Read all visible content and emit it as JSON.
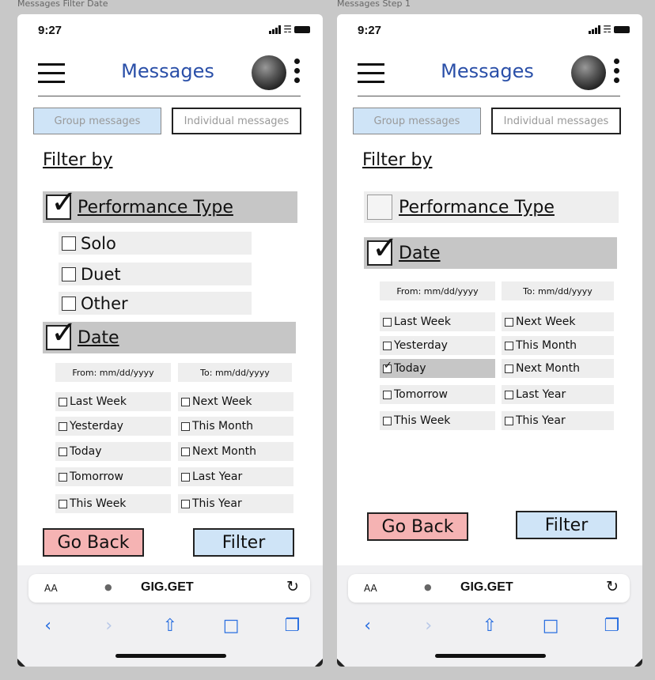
{
  "captions": [
    "Messages Filter Date",
    "Messages Step 1"
  ],
  "common": {
    "time": "9:27",
    "title": "Messages",
    "tabs": {
      "group": "Group messages",
      "individual": "Individual messages"
    },
    "filter_by": "Filter by",
    "sections": {
      "performance": "Performance Type",
      "date": "Date"
    },
    "perf_options": [
      "Solo",
      "Duet",
      "Other"
    ],
    "date_inputs": {
      "from": "From: mm/dd/yyyy",
      "to": "To: mm/dd/yyyy"
    },
    "date_left": [
      "Last Week",
      "Yesterday",
      "Today",
      "Tomorrow",
      "This Week"
    ],
    "date_right": [
      "Next Week",
      "This Month",
      "Next Month",
      "Last Year",
      "This Year"
    ],
    "buttons": {
      "back": "Go Back",
      "filter": "Filter"
    },
    "browser": {
      "aa": "AA",
      "domain": "GIG.GET",
      "lock_icon": "lock-icon",
      "reload_icon": "reload-icon"
    },
    "nav_icons": [
      "back-icon",
      "forward-icon",
      "share-icon",
      "bookmarks-icon",
      "tabs-icon"
    ]
  },
  "screens": [
    {
      "performance_checked": true,
      "date_checked": true,
      "today_checked": false
    },
    {
      "performance_checked": false,
      "date_checked": true,
      "today_checked": true
    }
  ],
  "colors": {
    "accent": "#2a4fa8",
    "back": "#f5b3b3",
    "filter": "#cfe4f7",
    "selected": "#c6c6c6"
  }
}
